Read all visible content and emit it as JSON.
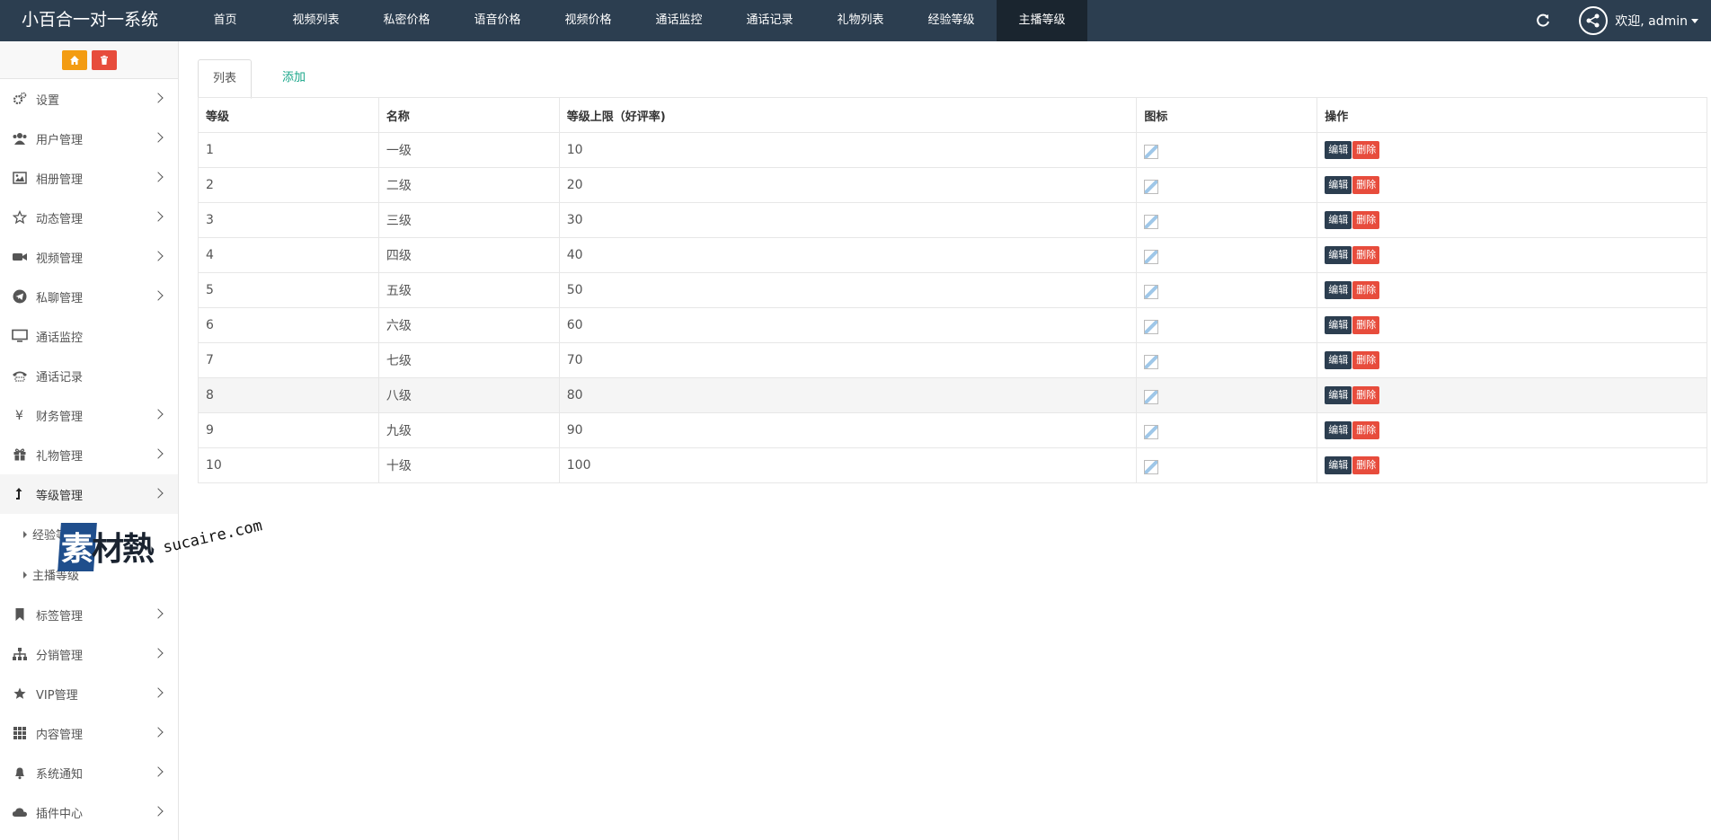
{
  "app": {
    "title": "小百合一对一系统"
  },
  "topnav": {
    "items": [
      "首页",
      "视频列表",
      "私密价格",
      "语音价格",
      "视频价格",
      "通话监控",
      "通话记录",
      "礼物列表",
      "经验等级",
      "主播等级"
    ],
    "active_index": 9
  },
  "user": {
    "welcome": "欢迎, admin"
  },
  "sidebar": {
    "menu": [
      {
        "label": "设置",
        "icon": "gears-icon",
        "has_chevron": true
      },
      {
        "label": "用户管理",
        "icon": "users-icon",
        "has_chevron": true
      },
      {
        "label": "相册管理",
        "icon": "image-icon",
        "has_chevron": true
      },
      {
        "label": "动态管理",
        "icon": "star-outline-icon",
        "has_chevron": true
      },
      {
        "label": "视频管理",
        "icon": "video-camera-icon",
        "has_chevron": true
      },
      {
        "label": "私聊管理",
        "icon": "telegram-icon",
        "has_chevron": true
      },
      {
        "label": "通话监控",
        "icon": "monitor-icon",
        "has_chevron": false
      },
      {
        "label": "通话记录",
        "icon": "phone-icon",
        "has_chevron": false
      },
      {
        "label": "财务管理",
        "icon": "yen-icon",
        "has_chevron": true
      },
      {
        "label": "礼物管理",
        "icon": "gift-icon",
        "has_chevron": true
      },
      {
        "label": "等级管理",
        "icon": "level-up-icon",
        "has_chevron": true,
        "open": true
      },
      {
        "label": "标签管理",
        "icon": "bookmark-icon",
        "has_chevron": true
      },
      {
        "label": "分销管理",
        "icon": "sitemap-icon",
        "has_chevron": true
      },
      {
        "label": "VIP管理",
        "icon": "star-icon",
        "has_chevron": true
      },
      {
        "label": "内容管理",
        "icon": "grid-icon",
        "has_chevron": true
      },
      {
        "label": "系统通知",
        "icon": "bell-icon",
        "has_chevron": true
      },
      {
        "label": "插件中心",
        "icon": "cloud-icon",
        "has_chevron": true
      }
    ],
    "submenu": [
      "经验等级",
      "主播等级"
    ]
  },
  "tabs": {
    "list": "列表",
    "add": "添加"
  },
  "table": {
    "headers": [
      "等级",
      "名称",
      "等级上限（好评率)",
      "图标",
      "操作"
    ],
    "rows": [
      {
        "level": "1",
        "name": "一级",
        "limit": "10"
      },
      {
        "level": "2",
        "name": "二级",
        "limit": "20"
      },
      {
        "level": "3",
        "name": "三级",
        "limit": "30"
      },
      {
        "level": "4",
        "name": "四级",
        "limit": "40"
      },
      {
        "level": "5",
        "name": "五级",
        "limit": "50"
      },
      {
        "level": "6",
        "name": "六级",
        "limit": "60"
      },
      {
        "level": "7",
        "name": "七级",
        "limit": "70"
      },
      {
        "level": "8",
        "name": "八级",
        "limit": "80"
      },
      {
        "level": "9",
        "name": "九级",
        "limit": "90"
      },
      {
        "level": "10",
        "name": "十级",
        "limit": "100"
      }
    ],
    "edit_label": "编辑",
    "delete_label": "删除",
    "hover_row": 7
  },
  "watermark": {
    "cn": "素材熱",
    "en": "sucaire.com"
  },
  "colors": {
    "topbar": "#2c3e50",
    "active_nav": "#1a252f",
    "link": "#18a689",
    "danger": "#e74c3c",
    "warning": "#f39c12"
  }
}
